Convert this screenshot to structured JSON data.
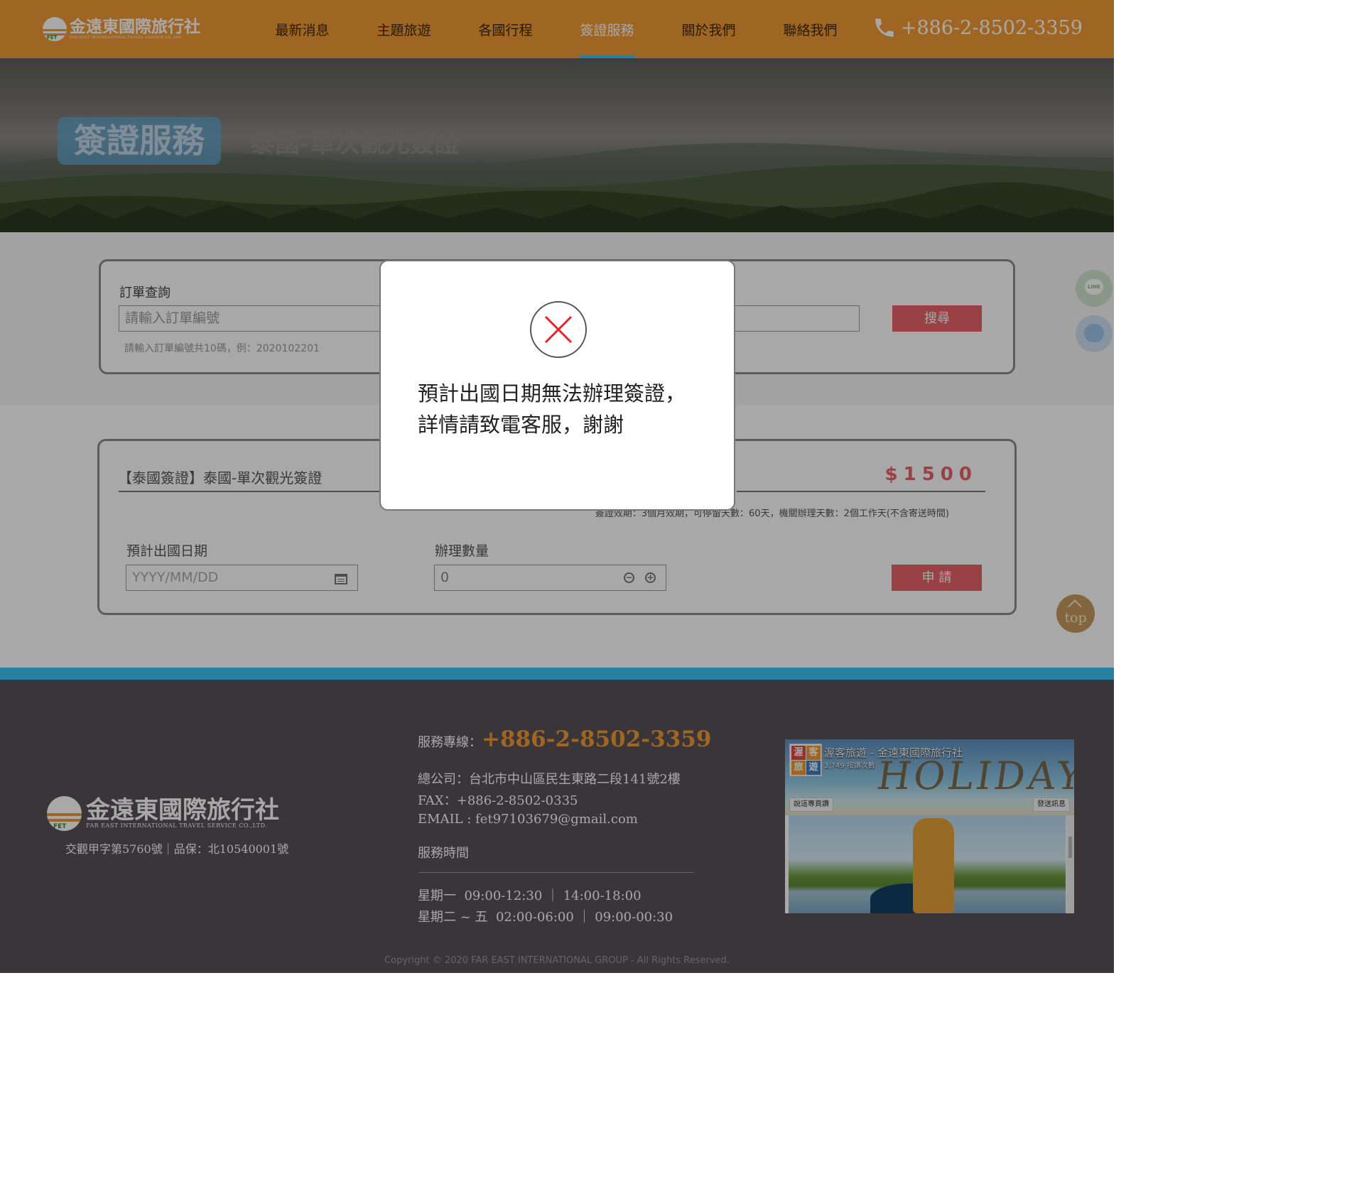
{
  "header": {
    "logo_zh": "金遠東國際旅行社",
    "logo_en": "FAR EAST INTERNATIONAL TRAVEL SERVICE CO.,LTD.",
    "nav": [
      {
        "label": "最新消息"
      },
      {
        "label": "主題旅遊"
      },
      {
        "label": "各國行程"
      },
      {
        "label": "簽證服務",
        "active": true
      },
      {
        "label": "關於我們"
      },
      {
        "label": "聯絡我們"
      }
    ],
    "phone": "+886-2-8502-3359"
  },
  "banner": {
    "title": "簽證服務",
    "subtitle": "泰國-單次觀光簽證"
  },
  "order_search": {
    "label": "訂單查詢",
    "placeholder": "請輸入訂單編號",
    "hint": "請輸入訂單編號共10碼，例：2020102201",
    "button": "搜尋"
  },
  "product": {
    "title": "【泰國簽證】泰國-單次觀光簽證",
    "price": "$1500",
    "meta": "簽證效期：3個月效期，可停留天數：60天，機關辦理天數：2個工作天(不含寄送時間)",
    "date_label": "預計出國日期",
    "date_placeholder": "YYYY/MM/DD",
    "qty_label": "辦理數量",
    "qty_value": "0",
    "apply_button": "申 請"
  },
  "floating": {
    "line_label": "LINE",
    "top_label": "top"
  },
  "footer": {
    "logo_zh": "金遠東國際旅行社",
    "logo_en": "FAR EAST INTERNATIONAL TRAVEL SERVICE CO.,LTD.",
    "license": "交觀甲字第5760號｜品保：北10540001號",
    "hotline_label": "服務專線：",
    "hotline": "+886-2-8502-3359",
    "address": "總公司：台北市中山區民生東路二段141號2樓",
    "fax": "FAX：+886-2-8502-0335",
    "email": "EMAIL : fet97103679@gmail.com",
    "hours_title": "服務時間",
    "hours": [
      "星期一  09:00-12:30 ｜ 14:00-18:00",
      "星期二 ~ 五  02:00-06:00 ｜ 09:00-00:30"
    ],
    "copyright": "Copyright © 2020 FAR EAST INTERNATIONAL GROUP - All Rights Reserved."
  },
  "fb_widget": {
    "avatar_chars": [
      "渥",
      "客",
      "旅",
      "遊"
    ],
    "page_name": "渥客旅遊 - 金遠東國際旅行社",
    "likes": "3,749 按讚次數",
    "cover_text": "HOLIDAYS",
    "like_button": "說這專頁讚",
    "message_button": "發送訊息"
  },
  "modal": {
    "message": "預計出國日期無法辦理簽證，詳情請致電客服，謝謝"
  },
  "colors": {
    "brand_orange": "#f29a35",
    "accent_blue": "#3ec6f2",
    "button_red": "#e9636a",
    "footer_bg": "#575157",
    "error_red": "#e8202a"
  }
}
